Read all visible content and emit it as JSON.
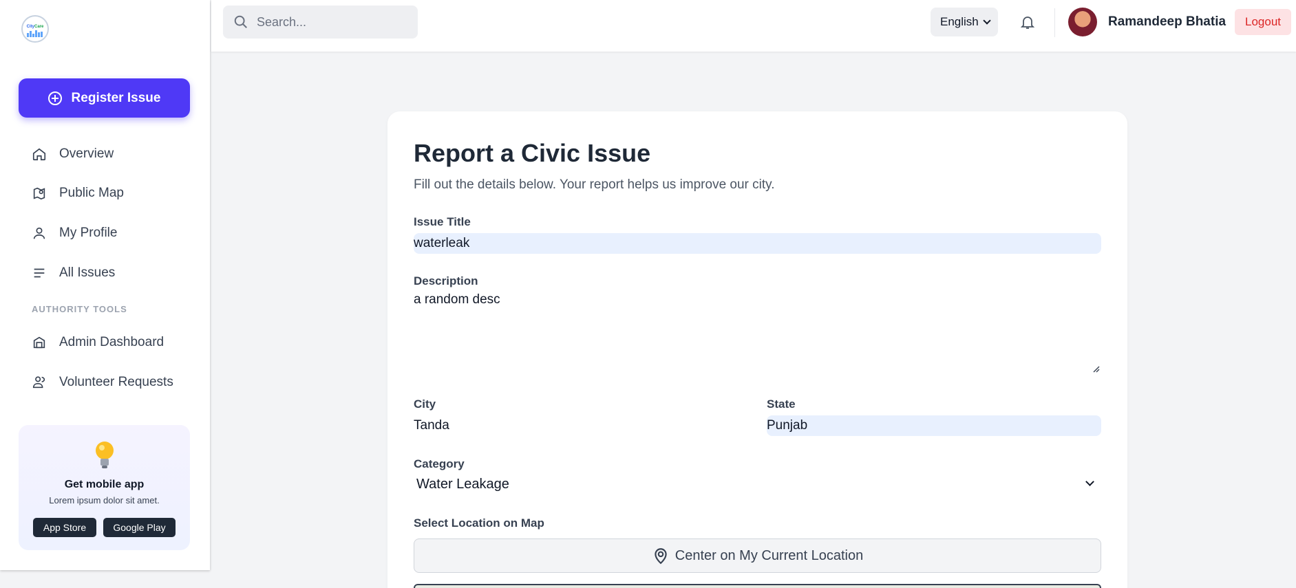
{
  "search": {
    "placeholder": "Search..."
  },
  "sidebar": {
    "register_label": "Register Issue",
    "items": [
      {
        "label": "Overview",
        "icon": "home-icon"
      },
      {
        "label": "Public Map",
        "icon": "map-icon"
      },
      {
        "label": "My Profile",
        "icon": "user-icon"
      },
      {
        "label": "All Issues",
        "icon": "list-icon"
      }
    ],
    "section_label": "AUTHORITY TOOLS",
    "authority_items": [
      {
        "label": "Admin Dashboard",
        "icon": "dashboard-icon"
      },
      {
        "label": "Volunteer Requests",
        "icon": "volunteer-icon"
      }
    ],
    "promo": {
      "title": "Get mobile app",
      "subtitle": "Lorem ipsum dolor sit amet.",
      "app_store": "App Store",
      "google_play": "Google Play"
    }
  },
  "header": {
    "language": "English",
    "username": "Ramandeep Bhatia",
    "logout_label": "Logout"
  },
  "form": {
    "title": "Report a Civic Issue",
    "subtitle": "Fill out the details below. Your report helps us improve our city.",
    "issue_title_label": "Issue Title",
    "issue_title_value": "waterleak",
    "description_label": "Description",
    "description_value": "a random desc",
    "city_label": "City",
    "city_value": "Tanda",
    "state_label": "State",
    "state_value": "Punjab",
    "category_label": "Category",
    "category_value": "Water Leakage",
    "location_label": "Select Location on Map",
    "location_button": "Center on My Current Location"
  },
  "colors": {
    "accent": "#4f39f6",
    "logout_bg": "#fde2e4",
    "logout_text": "#dc2626",
    "autofill_bg": "#e8f0fe"
  }
}
